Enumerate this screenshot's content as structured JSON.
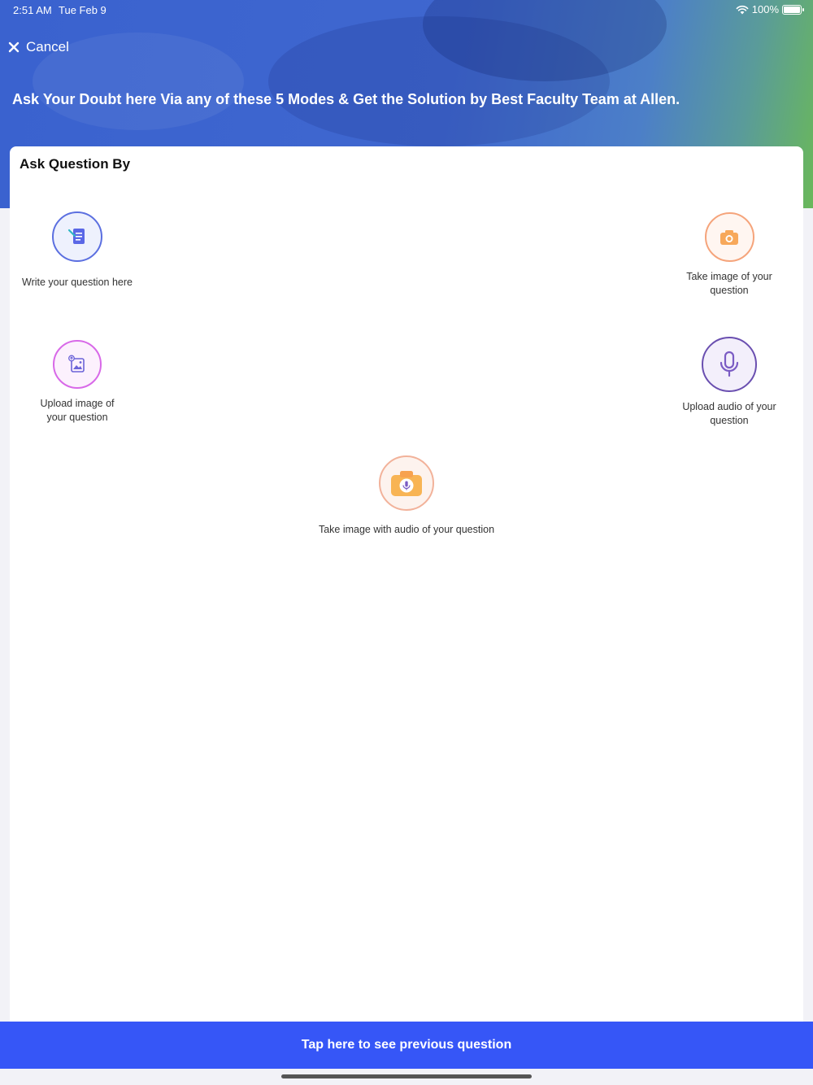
{
  "status_bar": {
    "time": "2:51 AM",
    "date": "Tue Feb 9",
    "battery": "100%"
  },
  "header": {
    "cancel_label": "Cancel",
    "headline": "Ask Your Doubt here Via any of these 5 Modes & Get the Solution by Best Faculty Team at Allen."
  },
  "card": {
    "title": "Ask Question By",
    "options": [
      {
        "label": "Write your question here",
        "icon": "write-question-icon"
      },
      {
        "label": "Take image of your question",
        "icon": "camera-icon"
      },
      {
        "label": "Upload image of your question",
        "icon": "upload-image-icon"
      },
      {
        "label": "Upload audio of your question",
        "icon": "microphone-icon"
      },
      {
        "label": "Take image with audio of your question",
        "icon": "camera-audio-icon"
      }
    ]
  },
  "footer": {
    "previous_label": "Tap here to see previous question"
  },
  "colors": {
    "accent": "#3656f7",
    "hero": "#3f67cf"
  }
}
